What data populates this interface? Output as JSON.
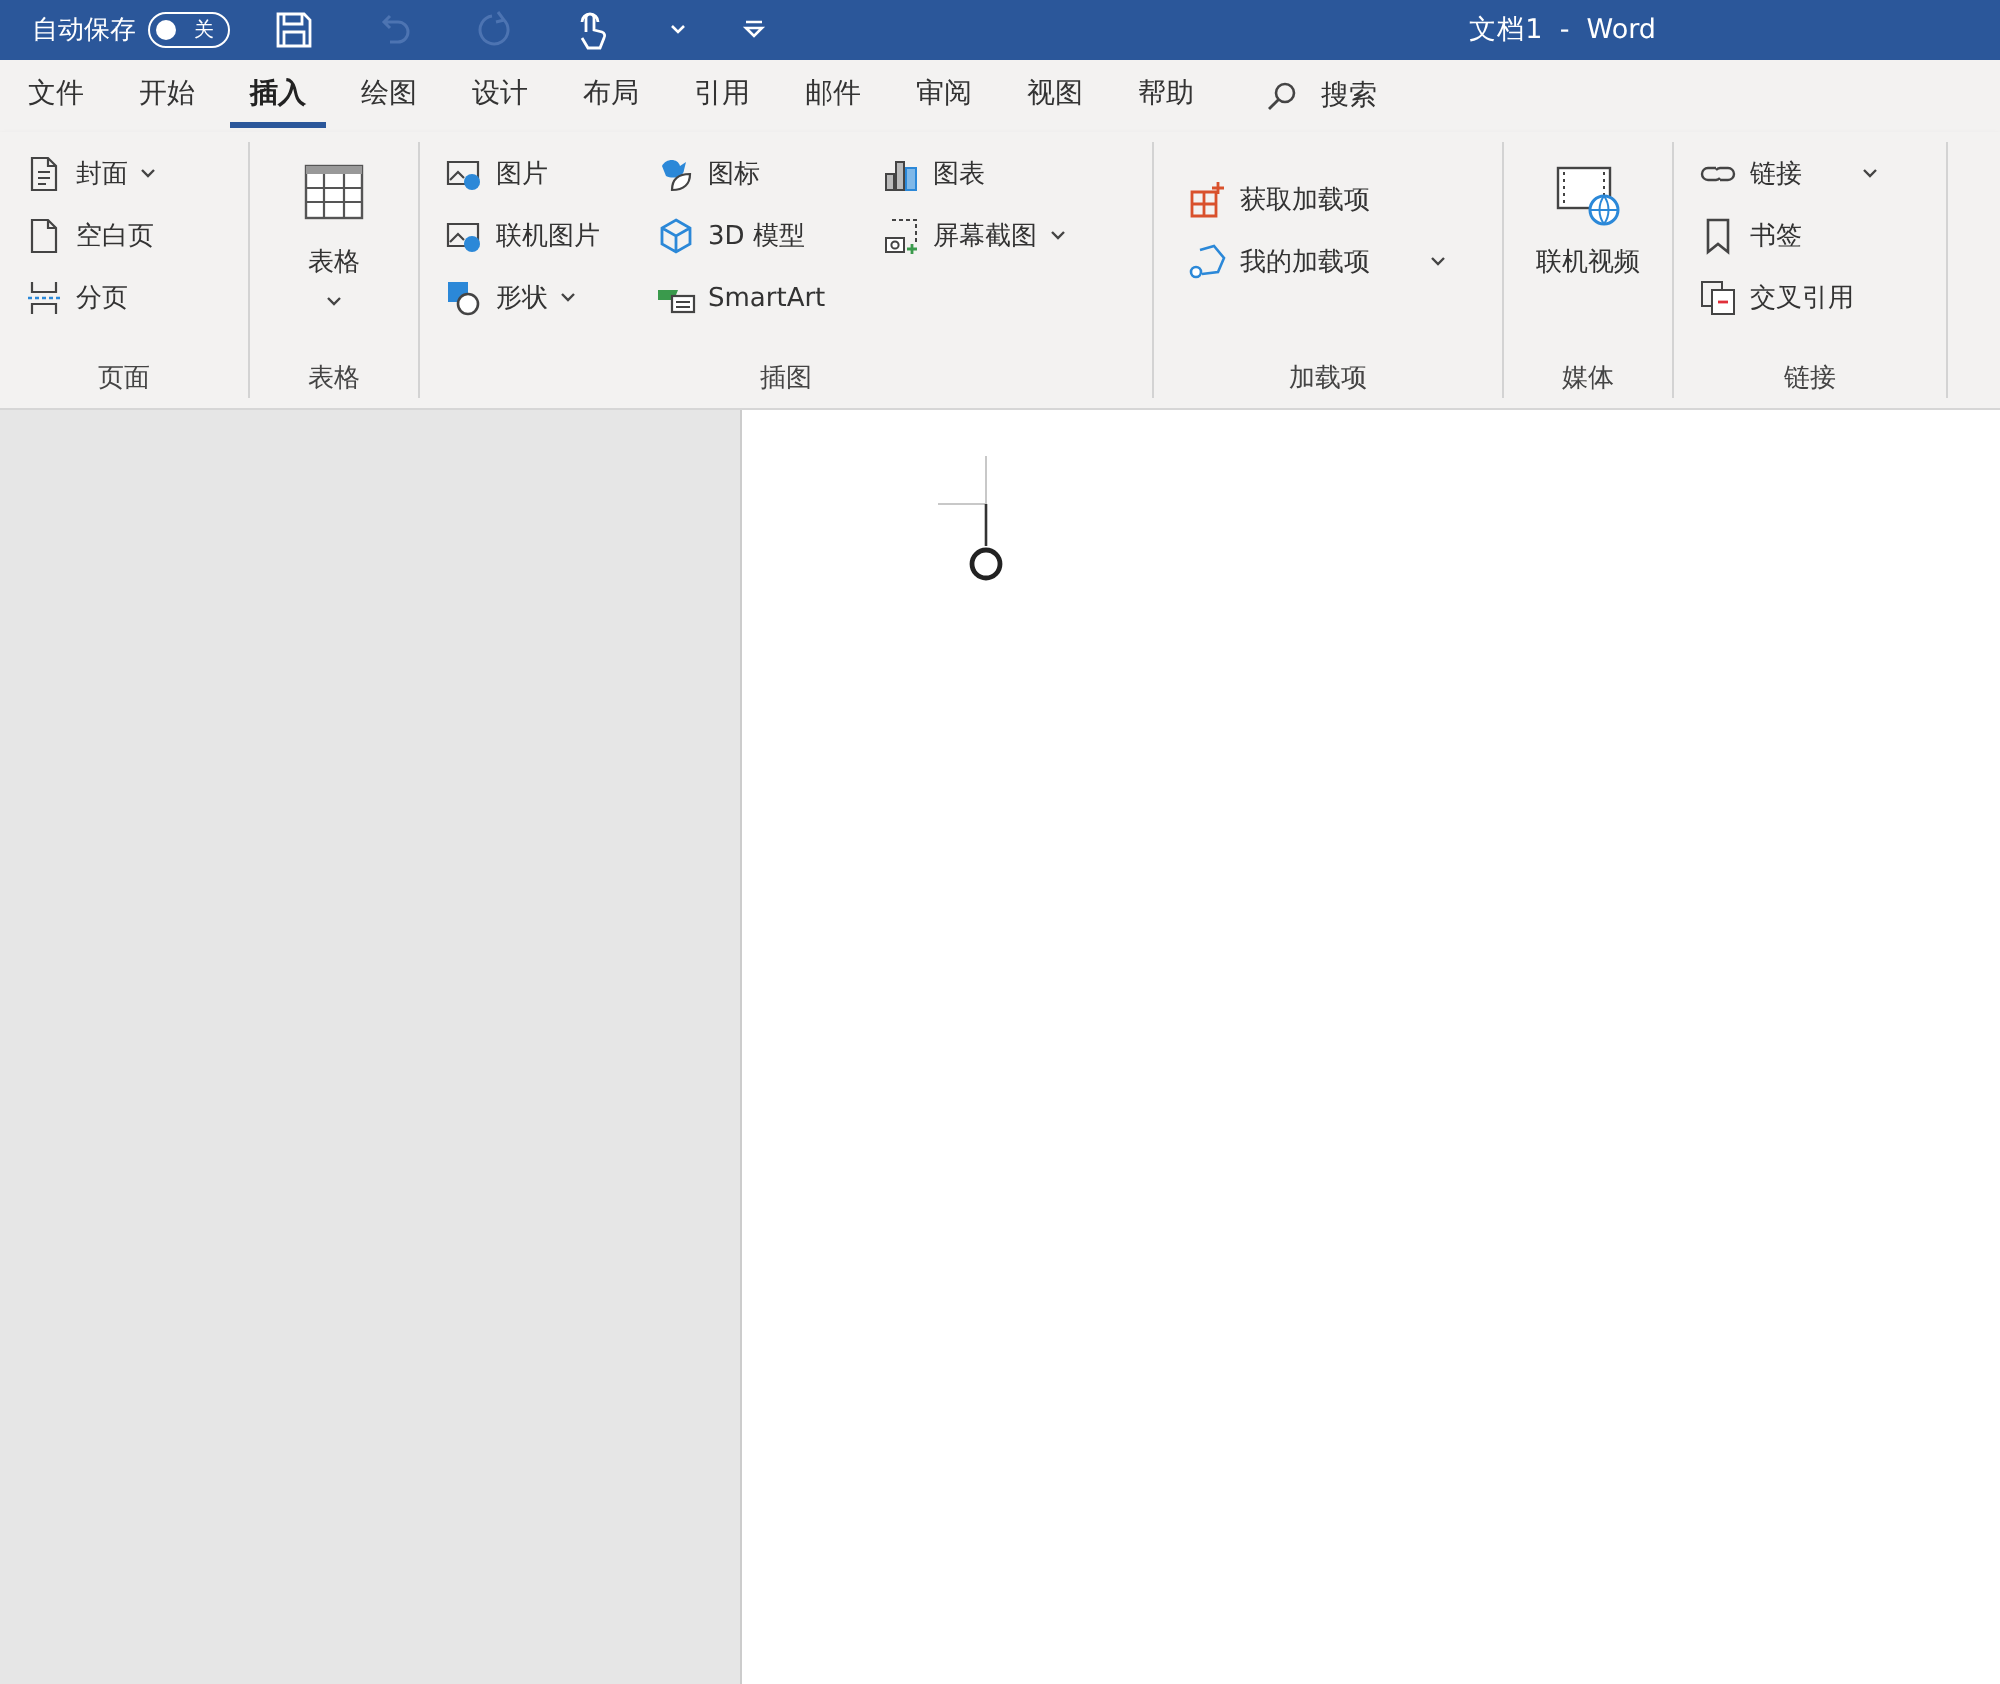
{
  "title_bar": {
    "autosave_label": "自动保存",
    "autosave_toggle": {
      "label": "关",
      "on": false
    },
    "title": "文档1  -  Word"
  },
  "tabs": [
    {
      "label": "文件",
      "selected": false
    },
    {
      "label": "开始",
      "selected": false
    },
    {
      "label": "插入",
      "selected": true
    },
    {
      "label": "绘图",
      "selected": false
    },
    {
      "label": "设计",
      "selected": false
    },
    {
      "label": "布局",
      "selected": false
    },
    {
      "label": "引用",
      "selected": false
    },
    {
      "label": "邮件",
      "selected": false
    },
    {
      "label": "审阅",
      "selected": false
    },
    {
      "label": "视图",
      "selected": false
    },
    {
      "label": "帮助",
      "selected": false
    }
  ],
  "search": {
    "label": "搜索"
  },
  "ribbon": {
    "groups": [
      {
        "name": "页面",
        "columns": [
          {
            "large": false,
            "items": [
              {
                "kind": "cover",
                "label": "封面",
                "dropdown": true
              },
              {
                "kind": "blank",
                "label": "空白页",
                "dropdown": false
              },
              {
                "kind": "pagebreak",
                "label": "分页",
                "dropdown": false
              }
            ]
          }
        ]
      },
      {
        "name": "表格",
        "columns": [
          {
            "large": true,
            "items": [
              {
                "kind": "table",
                "label": "表格",
                "dropdown": true
              }
            ]
          }
        ]
      },
      {
        "name": "插图",
        "columns": [
          {
            "large": false,
            "items": [
              {
                "kind": "picture",
                "label": "图片",
                "dropdown": false
              },
              {
                "kind": "onlinepicture",
                "label": "联机图片",
                "dropdown": false
              },
              {
                "kind": "shapes",
                "label": "形状",
                "dropdown": true
              }
            ]
          },
          {
            "large": false,
            "items": [
              {
                "kind": "icons",
                "label": "图标",
                "dropdown": false
              },
              {
                "kind": "model",
                "label": "3D 模型",
                "dropdown": false
              },
              {
                "kind": "smartart",
                "label": "SmartArt",
                "dropdown": false
              }
            ]
          },
          {
            "large": false,
            "items": [
              {
                "kind": "chart",
                "label": "图表",
                "dropdown": false
              },
              {
                "kind": "screenshot",
                "label": "屏幕截图",
                "dropdown": true
              }
            ]
          }
        ]
      },
      {
        "name": "加载项",
        "columns": [
          {
            "large": false,
            "items": [
              {
                "kind": "getaddins",
                "label": "获取加载项",
                "dropdown": false
              },
              {
                "kind": "myaddins",
                "label": "我的加载项",
                "dropdown": true
              }
            ]
          }
        ]
      },
      {
        "name": "媒体",
        "columns": [
          {
            "large": true,
            "items": [
              {
                "kind": "video",
                "label": "联机视频",
                "dropdown": false
              }
            ]
          }
        ]
      },
      {
        "name": "链接",
        "columns": [
          {
            "large": false,
            "items": [
              {
                "kind": "link",
                "label": "链接",
                "dropdown": true
              },
              {
                "kind": "bookmark",
                "label": "书签",
                "dropdown": false
              },
              {
                "kind": "crossref",
                "label": "交叉引用",
                "dropdown": false
              }
            ]
          }
        ]
      }
    ]
  }
}
